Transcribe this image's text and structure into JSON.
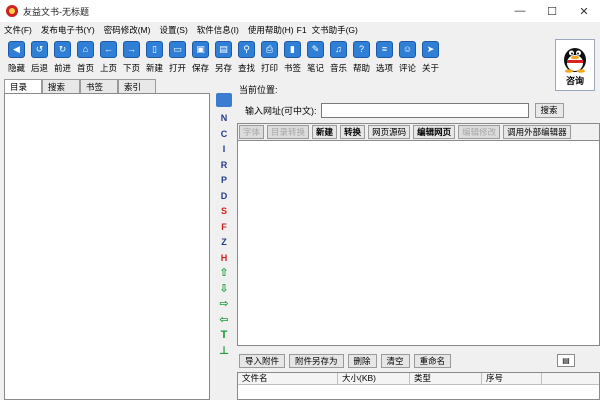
{
  "window": {
    "title": "友益文书-无标题",
    "controls": [
      "—",
      "☐",
      "✕"
    ]
  },
  "menu": [
    "文件(F)",
    "发布电子书(Y)",
    "密码修改(M)",
    "设置(S)",
    "软件信息(I)",
    "使用帮助(H)",
    "F1",
    "文书助手(G)"
  ],
  "toolbar": {
    "buttons": [
      {
        "label": "隐藏",
        "icon": "hide-icon",
        "glyph": "◀"
      },
      {
        "label": "后退",
        "icon": "back-refresh-icon",
        "glyph": "↺"
      },
      {
        "label": "前进",
        "icon": "forward-refresh-icon",
        "glyph": "↻"
      },
      {
        "label": "首页",
        "icon": "home-icon",
        "glyph": "⌂"
      },
      {
        "label": "上页",
        "icon": "prev-page-icon",
        "glyph": "←"
      },
      {
        "label": "下页",
        "icon": "next-page-icon",
        "glyph": "→"
      },
      {
        "label": "新建",
        "icon": "new-file-icon",
        "glyph": "▯"
      },
      {
        "label": "打开",
        "icon": "open-folder-icon",
        "glyph": "▭"
      },
      {
        "label": "保存",
        "icon": "save-icon",
        "glyph": "▣"
      },
      {
        "label": "另存",
        "icon": "save-as-icon",
        "glyph": "▤"
      },
      {
        "label": "查找",
        "icon": "find-icon",
        "glyph": "⚲"
      },
      {
        "label": "打印",
        "icon": "print-icon",
        "glyph": "⎙"
      },
      {
        "label": "书签",
        "icon": "bookmark-icon",
        "glyph": "▮"
      },
      {
        "label": "笔记",
        "icon": "note-icon",
        "glyph": "✎"
      },
      {
        "label": "音乐",
        "icon": "music-icon",
        "glyph": "♫"
      },
      {
        "label": "帮助",
        "icon": "help-icon",
        "glyph": "?"
      },
      {
        "label": "选项",
        "icon": "options-icon",
        "glyph": "≡"
      },
      {
        "label": "评论",
        "icon": "comment-icon",
        "glyph": "☺"
      },
      {
        "label": "关于",
        "icon": "about-icon",
        "glyph": "➤"
      }
    ],
    "qq_label": "咨询"
  },
  "left": {
    "tabs": [
      "目录",
      "搜索",
      "书签",
      "索引"
    ],
    "active_tab": "目录",
    "side_tools": [
      {
        "text": "N",
        "red": false
      },
      {
        "text": "C",
        "red": false
      },
      {
        "text": "I",
        "red": false
      },
      {
        "text": "R",
        "red": false
      },
      {
        "text": "P",
        "red": false
      },
      {
        "text": "D",
        "red": false
      },
      {
        "text": "S",
        "red": true
      },
      {
        "text": "F",
        "red": true
      },
      {
        "text": "Z",
        "red": false
      },
      {
        "text": "H",
        "red": true
      }
    ],
    "side_arrows": [
      "⇧",
      "⇩",
      "⇨",
      "⇦",
      "T",
      "⊥"
    ]
  },
  "right": {
    "location_label": "当前位置:",
    "url_label": "输入网址(可中文):",
    "url_value": "",
    "search_label": "搜索",
    "editor_buttons": [
      {
        "label": "字体",
        "disabled": true,
        "bold": false
      },
      {
        "label": "目录转换",
        "disabled": true,
        "bold": false
      },
      {
        "label": "新建",
        "disabled": false,
        "bold": true
      },
      {
        "label": "转换",
        "disabled": false,
        "bold": true
      },
      {
        "label": "网页源码",
        "disabled": false,
        "bold": false
      },
      {
        "label": "编辑网页",
        "disabled": false,
        "bold": true
      },
      {
        "label": "编辑修改",
        "disabled": true,
        "bold": false
      },
      {
        "label": "调用外部编辑器",
        "disabled": false,
        "bold": false
      }
    ],
    "attachment_buttons": [
      "导入附件",
      "附件另存为",
      "删除",
      "清空",
      "重命名"
    ],
    "attachment_columns": [
      "文件名",
      "大小(KB)",
      "类型",
      "序号"
    ]
  }
}
